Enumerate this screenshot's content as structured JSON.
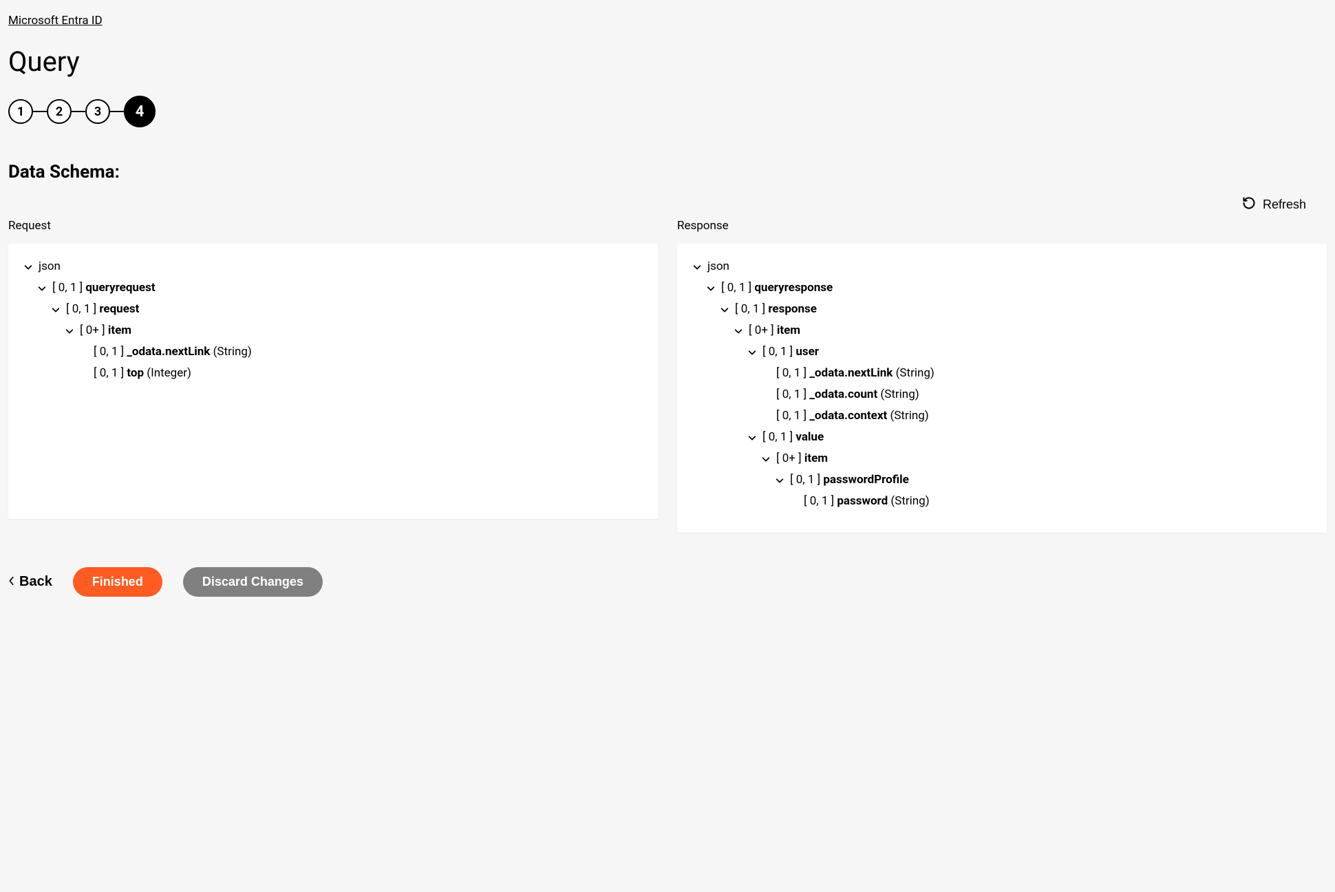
{
  "breadcrumb": {
    "label": "Microsoft Entra ID"
  },
  "page_title": "Query",
  "stepper": {
    "steps": [
      "1",
      "2",
      "3",
      "4"
    ],
    "active_index": 3
  },
  "section_heading": "Data Schema:",
  "refresh": {
    "label": "Refresh"
  },
  "columns": {
    "request": {
      "header": "Request",
      "rows": [
        {
          "indent": 0,
          "caret": true,
          "card": "",
          "name": "json",
          "name_bold": false,
          "type": ""
        },
        {
          "indent": 1,
          "caret": true,
          "card": "[ 0, 1 ] ",
          "name": "queryrequest",
          "name_bold": true,
          "type": ""
        },
        {
          "indent": 2,
          "caret": true,
          "card": "[ 0, 1 ] ",
          "name": "request",
          "name_bold": true,
          "type": ""
        },
        {
          "indent": 3,
          "caret": true,
          "card": "[ 0+ ] ",
          "name": "item",
          "name_bold": true,
          "type": ""
        },
        {
          "indent": 4,
          "caret": false,
          "card": "[ 0, 1 ] ",
          "name": "_odata.nextLink",
          "name_bold": true,
          "type": " (String)"
        },
        {
          "indent": 4,
          "caret": false,
          "card": "[ 0, 1 ] ",
          "name": "top",
          "name_bold": true,
          "type": " (Integer)"
        }
      ]
    },
    "response": {
      "header": "Response",
      "rows": [
        {
          "indent": 0,
          "caret": true,
          "card": "",
          "name": "json",
          "name_bold": false,
          "type": ""
        },
        {
          "indent": 1,
          "caret": true,
          "card": "[ 0, 1 ] ",
          "name": "queryresponse",
          "name_bold": true,
          "type": ""
        },
        {
          "indent": 2,
          "caret": true,
          "card": "[ 0, 1 ] ",
          "name": "response",
          "name_bold": true,
          "type": ""
        },
        {
          "indent": 3,
          "caret": true,
          "card": "[ 0+ ] ",
          "name": "item",
          "name_bold": true,
          "type": ""
        },
        {
          "indent": 4,
          "caret": true,
          "card": "[ 0, 1 ] ",
          "name": "user",
          "name_bold": true,
          "type": ""
        },
        {
          "indent": 5,
          "caret": false,
          "card": "[ 0, 1 ] ",
          "name": "_odata.nextLink",
          "name_bold": true,
          "type": " (String)"
        },
        {
          "indent": 5,
          "caret": false,
          "card": "[ 0, 1 ] ",
          "name": "_odata.count",
          "name_bold": true,
          "type": " (String)"
        },
        {
          "indent": 5,
          "caret": false,
          "card": "[ 0, 1 ] ",
          "name": "_odata.context",
          "name_bold": true,
          "type": " (String)"
        },
        {
          "indent": 4,
          "caret": true,
          "card": "[ 0, 1 ] ",
          "name": "value",
          "name_bold": true,
          "type": ""
        },
        {
          "indent": 5,
          "caret": true,
          "card": "[ 0+ ] ",
          "name": "item",
          "name_bold": true,
          "type": ""
        },
        {
          "indent": 6,
          "caret": true,
          "card": "[ 0, 1 ] ",
          "name": "passwordProfile",
          "name_bold": true,
          "type": ""
        },
        {
          "indent": 7,
          "caret": false,
          "card": "[ 0, 1 ] ",
          "name": "password",
          "name_bold": true,
          "type": " (String)"
        }
      ]
    }
  },
  "footer": {
    "back": "Back",
    "finished": "Finished",
    "discard": "Discard Changes"
  }
}
